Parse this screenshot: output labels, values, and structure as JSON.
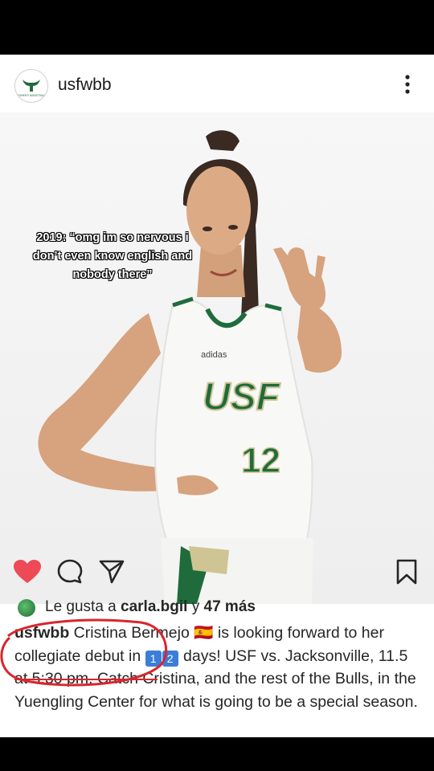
{
  "post": {
    "username": "usfwbb",
    "avatar_label": "WOMEN'S BASKETBALL",
    "overlay_text": "2019: “omg im so nervous i don’t even know english and nobody there”",
    "photo": {
      "jersey_brand": "adidas",
      "jersey_logo": "USF",
      "jersey_number": "12"
    },
    "actions": {
      "like_icon": "heart-icon",
      "comment_icon": "comment-icon",
      "share_icon": "send-icon",
      "save_icon": "bookmark-icon",
      "liked": true
    },
    "likes": {
      "prefix": "Le gusta a ",
      "user": "carla.bgil",
      "mid": " y ",
      "count": "47 más"
    },
    "caption": {
      "username": "usfwbb",
      "name": "Cristina Bermejo",
      "flag": "🇪🇸",
      "text_1": " is looking forward to her collegiate debut in ",
      "keycap_1": "1",
      "keycap_2": "2",
      "text_2": " days! USF vs. Jacksonville, 11.5 at 5:30 pm. Catch Cristina, and the rest of the Bulls, in the Yuengling Center for what is going to be a special season."
    }
  },
  "colors": {
    "heart": "#ed4956",
    "annotation": "#d9262c",
    "usf_green": "#006747",
    "usf_gold": "#cfc493"
  }
}
